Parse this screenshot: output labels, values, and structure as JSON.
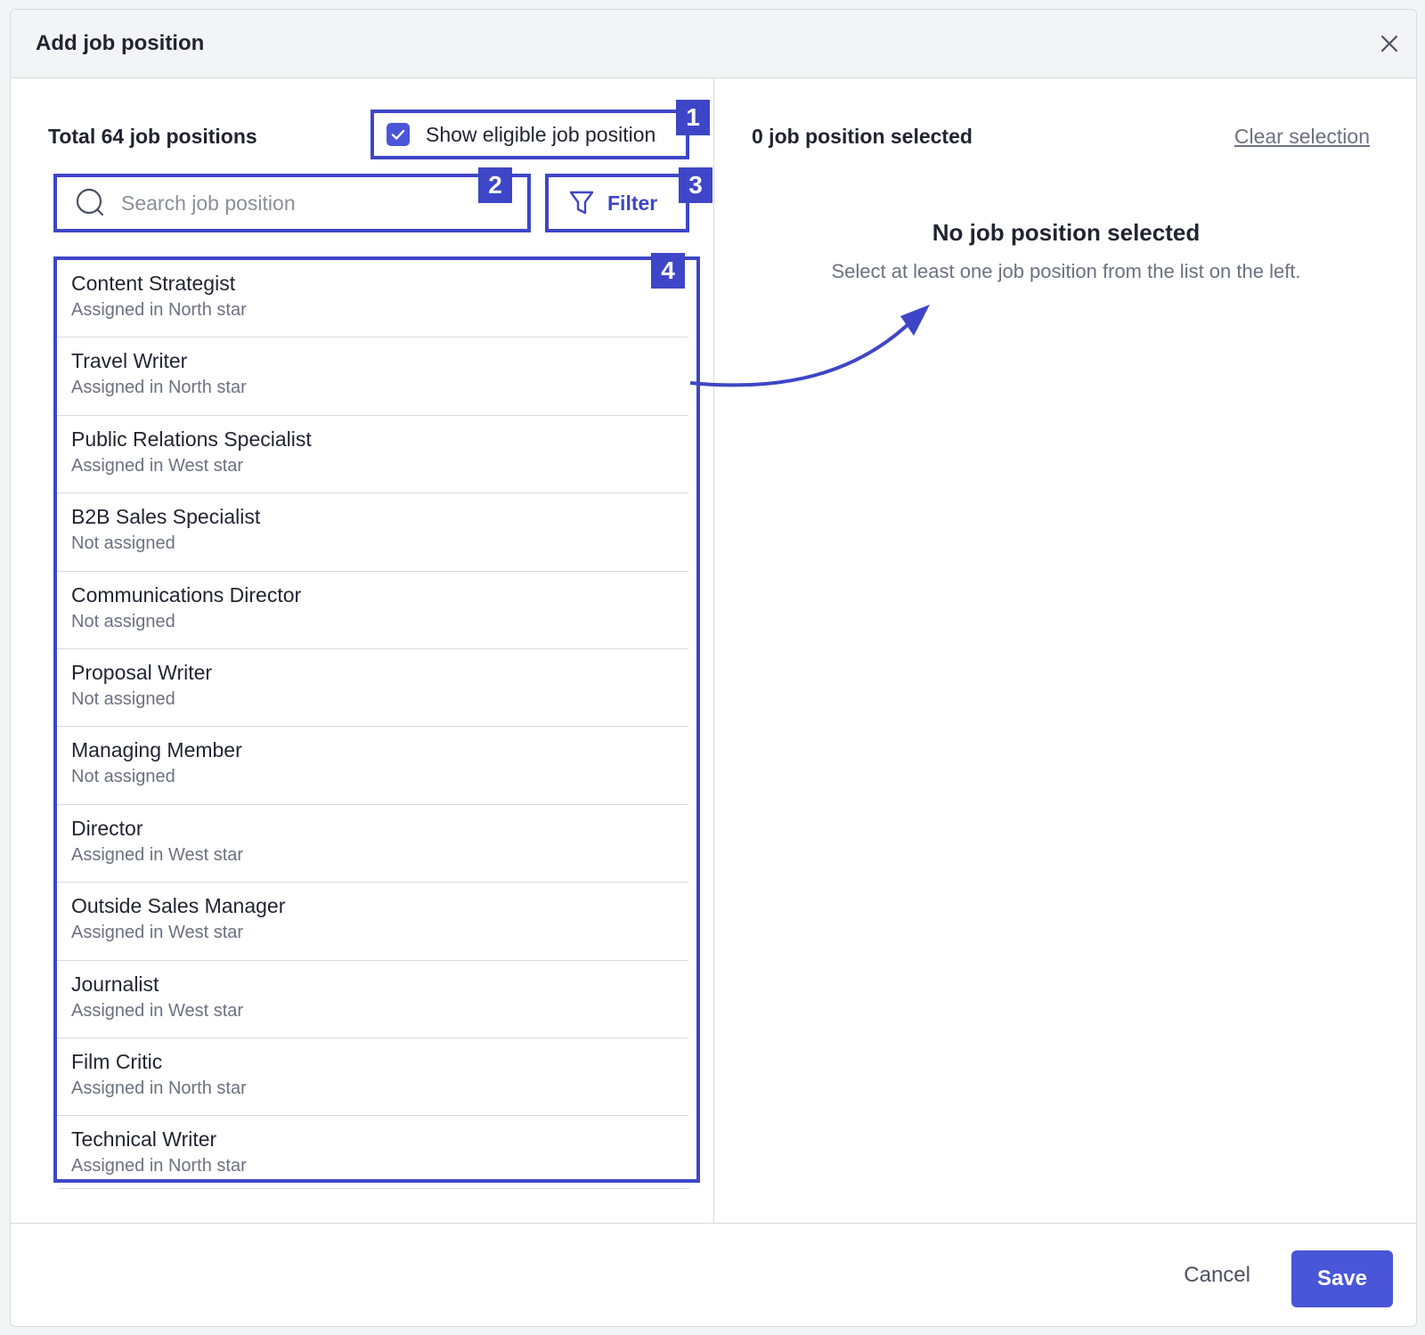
{
  "modal": {
    "title": "Add job position",
    "close_icon": "close-icon"
  },
  "left": {
    "total_label": "Total 64 job positions",
    "eligible_label": "Show eligible job position",
    "eligible_checked": true,
    "search_placeholder": "Search job position",
    "filter_label": "Filter",
    "items": [
      {
        "name": "Content Strategist",
        "sub": "Assigned in North star"
      },
      {
        "name": "Travel Writer",
        "sub": "Assigned in North star"
      },
      {
        "name": "Public Relations Specialist",
        "sub": "Assigned in West star"
      },
      {
        "name": "B2B Sales Specialist",
        "sub": "Not assigned"
      },
      {
        "name": "Communications Director",
        "sub": "Not assigned"
      },
      {
        "name": "Proposal Writer",
        "sub": "Not assigned"
      },
      {
        "name": "Managing Member",
        "sub": "Not assigned"
      },
      {
        "name": "Director",
        "sub": "Assigned in West star"
      },
      {
        "name": "Outside Sales Manager",
        "sub": "Assigned in West star"
      },
      {
        "name": "Journalist",
        "sub": "Assigned in West star"
      },
      {
        "name": "Film Critic",
        "sub": "Assigned in North star"
      },
      {
        "name": "Technical Writer",
        "sub": "Assigned in North star"
      }
    ]
  },
  "right": {
    "selected_count": "0 job position selected",
    "clear_label": "Clear selection",
    "empty_title": "No job position selected",
    "empty_subtitle": "Select at least one job position from the list on the left."
  },
  "footer": {
    "cancel_label": "Cancel",
    "save_label": "Save"
  },
  "annotations": {
    "badge_1": "1",
    "badge_2": "2",
    "badge_3": "3",
    "badge_4": "4"
  },
  "colors": {
    "accent": "#3e46c7",
    "primary_button": "#4a56d8",
    "muted_text": "#6b7280"
  }
}
